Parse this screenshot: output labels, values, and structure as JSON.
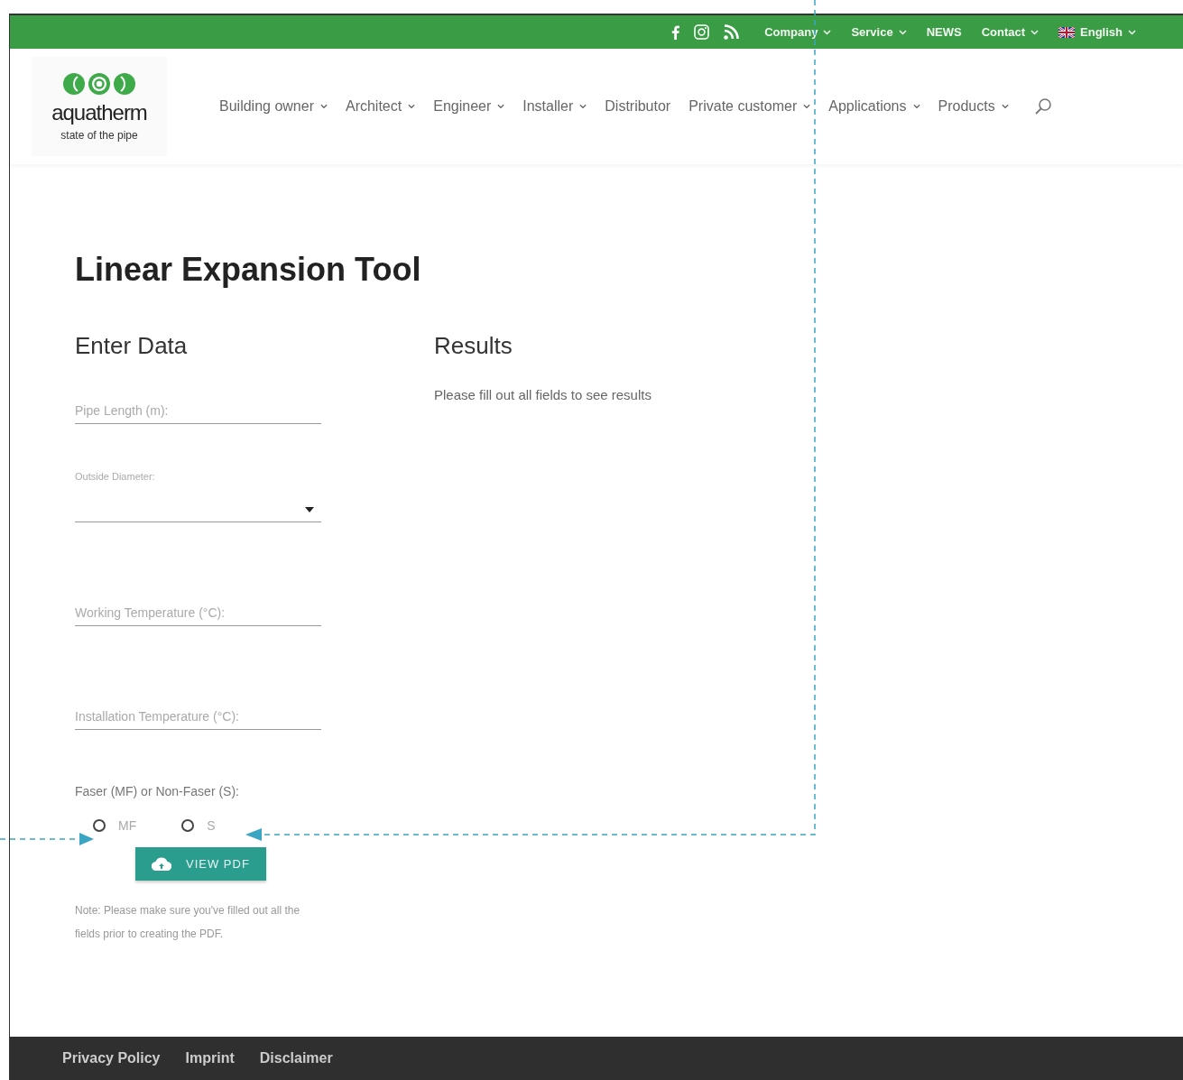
{
  "top_bar": {
    "social": [
      {
        "kind": "facebook"
      },
      {
        "kind": "instagram"
      },
      {
        "kind": "rss"
      }
    ],
    "links": [
      {
        "label": "Company",
        "dropdown": true
      },
      {
        "label": "Service",
        "dropdown": true
      },
      {
        "label": "NEWS",
        "dropdown": false
      },
      {
        "label": "Contact",
        "dropdown": true
      },
      {
        "label": "English",
        "dropdown": true,
        "flag": true
      }
    ]
  },
  "logo": {
    "name": "aquatherm",
    "tagline": "state of the pipe"
  },
  "nav": [
    {
      "label": "Building owner",
      "dropdown": true
    },
    {
      "label": "Architect",
      "dropdown": true
    },
    {
      "label": "Engineer",
      "dropdown": true
    },
    {
      "label": "Installer",
      "dropdown": true
    },
    {
      "label": "Distributor",
      "dropdown": false
    },
    {
      "label": "Private customer",
      "dropdown": true
    },
    {
      "label": "Applications",
      "dropdown": true
    },
    {
      "label": "Products",
      "dropdown": true
    }
  ],
  "title": "Linear Expansion Tool",
  "form": {
    "heading": "Enter Data",
    "fields": [
      {
        "kind": "input",
        "placeholder": "Pipe Length (m):"
      },
      {
        "kind": "select",
        "label": "Outside Diameter:"
      },
      {
        "kind": "input",
        "placeholder": "Working Temperature (°C):"
      },
      {
        "kind": "input",
        "placeholder": "Installation Temperature (°C):"
      }
    ],
    "radio_label": "Faser (MF) or Non-Faser (S):",
    "radios": [
      {
        "label": "MF",
        "selected": false
      },
      {
        "label": "S",
        "selected": false
      }
    ],
    "button": "VIEW PDF",
    "note": "Note: Please make sure you've filled out all the fields prior to creating the PDF."
  },
  "results": {
    "heading": "Results",
    "message": "Please fill out all fields to see results"
  },
  "footer": [
    "Privacy Policy",
    "Imprint",
    "Disclaimer"
  ]
}
